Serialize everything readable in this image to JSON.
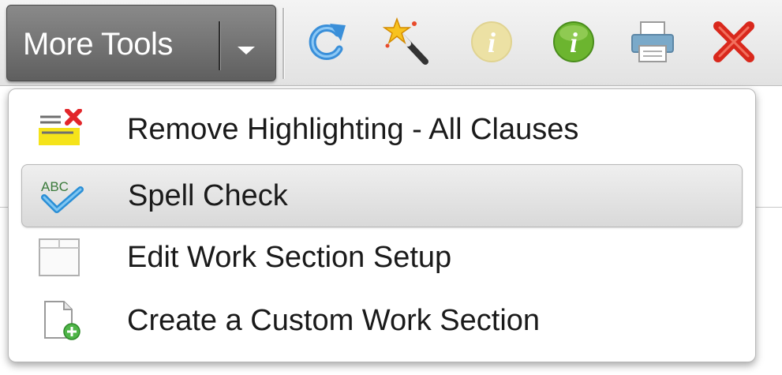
{
  "toolbar": {
    "more_tools": {
      "label": "More Tools",
      "caret_icon": "chevron-down-icon"
    },
    "icons": [
      {
        "name": "refresh-icon",
        "enabled": true
      },
      {
        "name": "magic-wand-icon",
        "enabled": true
      },
      {
        "name": "info-icon",
        "enabled": false
      },
      {
        "name": "info-icon",
        "enabled": true
      },
      {
        "name": "print-icon",
        "enabled": true
      },
      {
        "name": "close-icon",
        "enabled": true
      }
    ]
  },
  "menu": {
    "items": [
      {
        "label": "Remove Highlighting - All Clauses",
        "icon": "remove-highlighting-icon",
        "highlighted": false
      },
      {
        "label": "Spell Check",
        "icon": "spell-check-icon",
        "highlighted": true
      },
      {
        "label": "Edit Work Section Setup",
        "icon": "edit-section-icon",
        "highlighted": false
      },
      {
        "label": "Create a Custom Work Section",
        "icon": "new-document-icon",
        "highlighted": false
      }
    ]
  }
}
